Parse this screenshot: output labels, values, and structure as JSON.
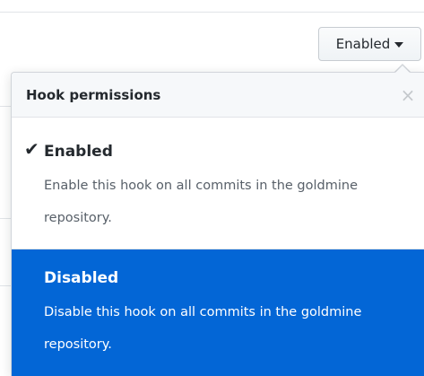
{
  "trigger": {
    "label": "Enabled"
  },
  "menu": {
    "title": "Hook permissions",
    "close_glyph": "×",
    "items": [
      {
        "title": "Enabled",
        "description": "Enable this hook on all commits in the goldmine repository.",
        "selected": true,
        "check_glyph": "✔"
      },
      {
        "title": "Disabled",
        "description": "Disable this hook on all commits in the goldmine repository.",
        "selected": false,
        "highlighted": true
      }
    ]
  },
  "colors": {
    "highlight": "#0366d6",
    "header_bg": "#f6f8fa",
    "muted_text": "#586069"
  },
  "icons": {
    "check": "check-icon",
    "close": "close-icon",
    "caret": "caret-down-icon"
  }
}
